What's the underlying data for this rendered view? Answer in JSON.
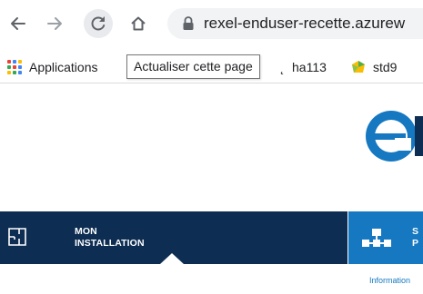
{
  "browser": {
    "url": "rexel-enduser-recette.azurew",
    "reload_tooltip": "Actualiser cette page"
  },
  "bookmarks": {
    "apps_label": "Applications",
    "partial_label": "̨",
    "items": [
      {
        "label": "ha113"
      },
      {
        "label": "std9"
      }
    ]
  },
  "menu": {
    "mon_installation": {
      "line1": "MON",
      "line2": "INSTALLATION"
    },
    "second": {
      "line1": "S",
      "line2": "P"
    }
  },
  "content": {
    "info_link": "Information"
  },
  "colors": {
    "menu_dark": "#0d2d52",
    "menu_blue": "#1578c0",
    "logo_blue": "#1578c0",
    "logo_dark": "#0d2d52"
  }
}
